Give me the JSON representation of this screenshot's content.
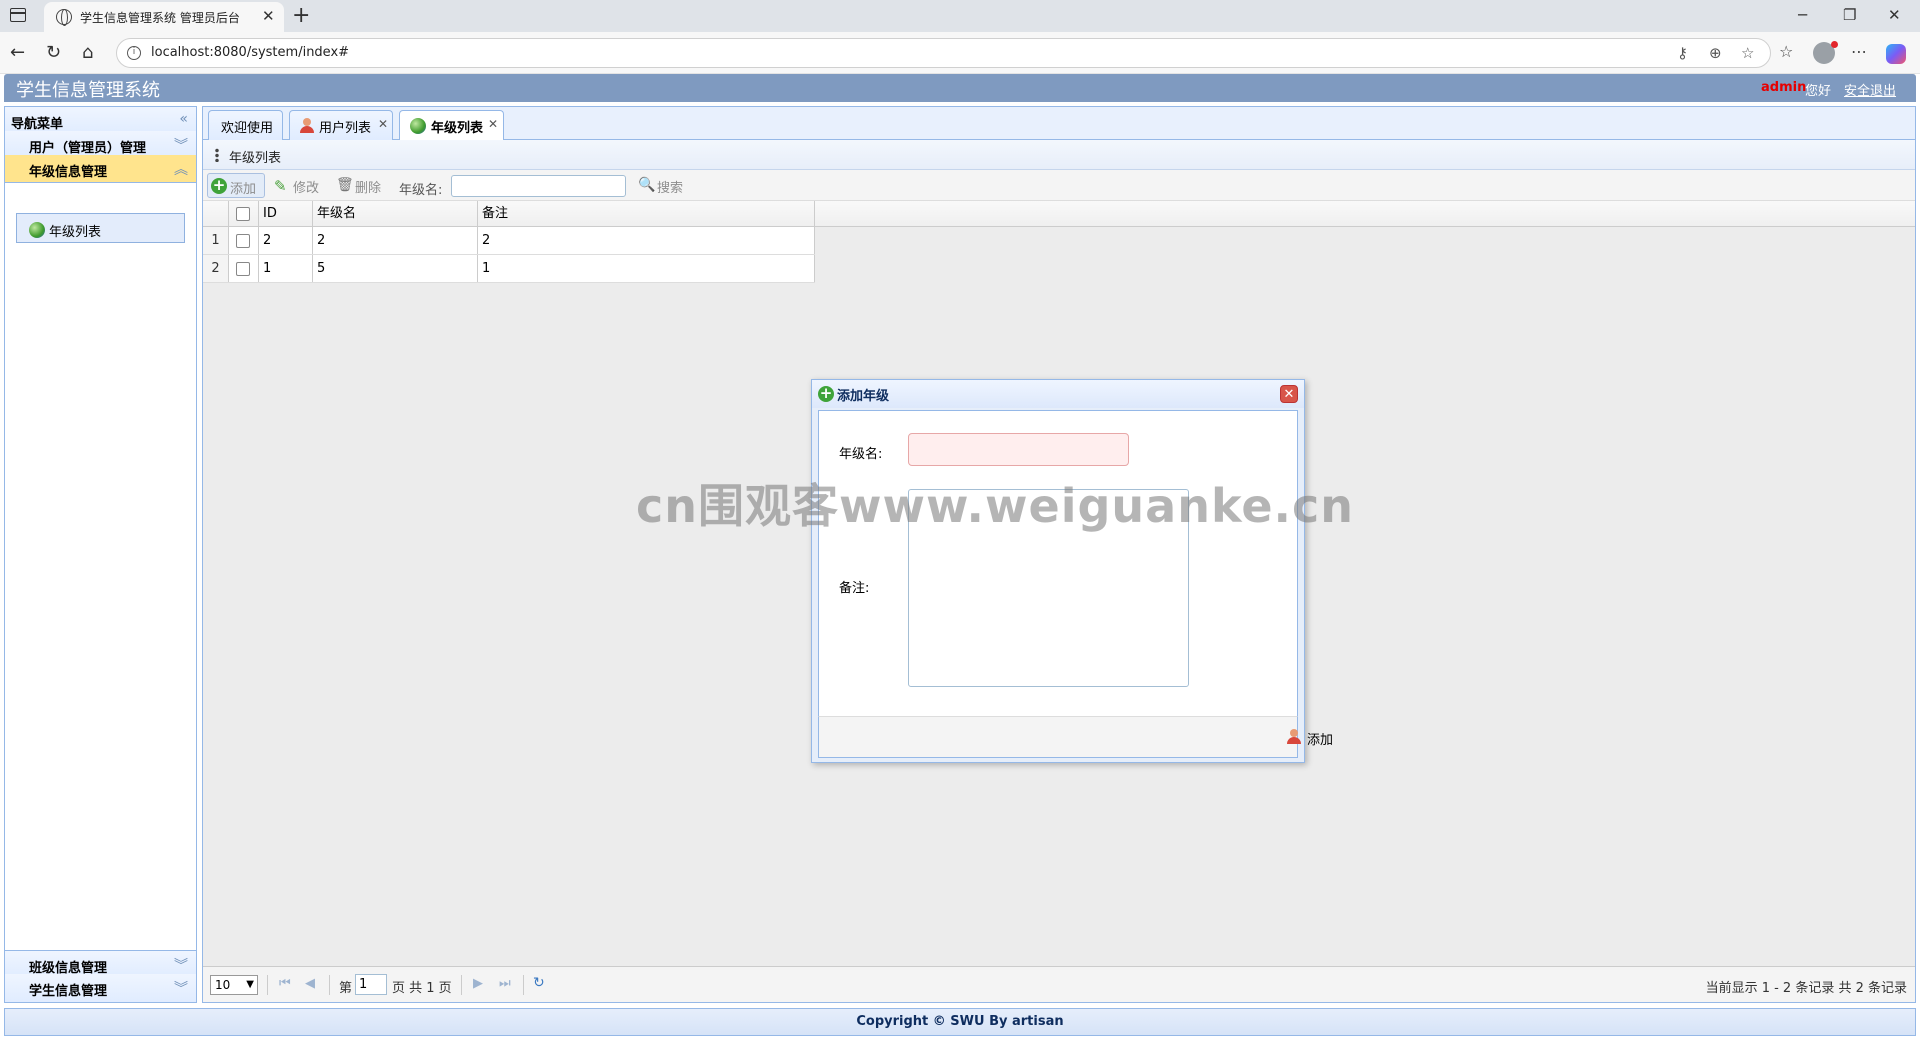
{
  "browser": {
    "tab_title": "学生信息管理系统 管理员后台",
    "url": "localhost:8080/system/index#"
  },
  "app": {
    "title": "学生信息管理系统",
    "admin_name": "admin",
    "greeting": "您好",
    "logout": "安全退出",
    "footer": "Copyright © SWU By artisan"
  },
  "sidebar": {
    "title": "导航菜单",
    "panels": [
      {
        "label": "用户（管理员）管理"
      },
      {
        "label": "年级信息管理",
        "items": [
          {
            "label": "年级列表"
          }
        ]
      },
      {
        "label": "班级信息管理"
      },
      {
        "label": "学生信息管理"
      }
    ]
  },
  "tabs": [
    {
      "label": "欢迎使用"
    },
    {
      "label": "用户列表"
    },
    {
      "label": "年级列表"
    }
  ],
  "grid": {
    "title": "年级列表",
    "toolbar": {
      "add": "添加",
      "edit": "修改",
      "delete": "删除",
      "search_label": "年级名:",
      "search_value": "",
      "search": "搜索"
    },
    "columns": [
      "ID",
      "年级名",
      "备注"
    ],
    "rows": [
      {
        "num": "1",
        "id": "2",
        "name": "2",
        "remark": "2"
      },
      {
        "num": "2",
        "id": "1",
        "name": "5",
        "remark": "1"
      }
    ],
    "pager": {
      "page_size": "10",
      "page_prefix": "第",
      "page": "1",
      "page_suffix": "页 共 1 页",
      "info": "当前显示 1 - 2 条记录 共 2 条记录"
    }
  },
  "dialog": {
    "title": "添加年级",
    "name_label": "年级名:",
    "name_value": "",
    "remark_label": "备注:",
    "remark_value": "",
    "add_button": "添加"
  },
  "watermark": "cn围观客www.weiguanke.cn",
  "colors": {
    "header_bg": "#7f9ac0",
    "accent_panel": "#ffe48d",
    "admin_name": "#e60000",
    "border": "#95b8e7"
  }
}
